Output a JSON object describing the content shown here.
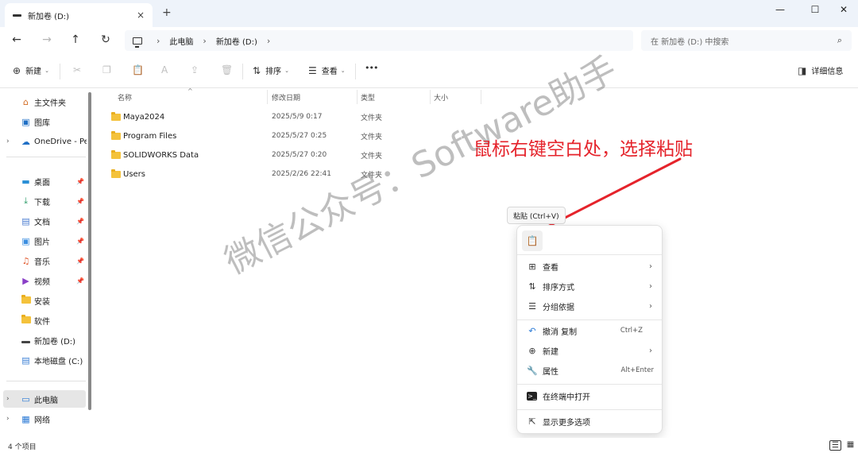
{
  "window": {
    "tab_title": "新加卷 (D:)",
    "tab_close_icon": "×",
    "new_tab_icon": "+",
    "minimize_icon": "—",
    "maximize_icon": "☐",
    "close_icon": "✕"
  },
  "address_bar": {
    "back_icon": "←",
    "forward_icon": "→",
    "up_icon": "↑",
    "refresh_icon": "↻",
    "separator": "›",
    "crumbs": [
      "此电脑",
      "新加卷 (D:)"
    ],
    "search_placeholder": "在 新加卷 (D:) 中搜索",
    "search_icon": "⌕"
  },
  "toolbar": {
    "new_icon": "⊕",
    "new_label": "新建",
    "cut_icon": "✂",
    "copy_icon": "❐",
    "paste_icon": "📋",
    "rename_icon": "A",
    "share_icon": "⇪",
    "delete_icon": "🗑",
    "sort_icon": "⇅",
    "sort_label": "排序",
    "view_icon": "☰",
    "view_label": "查看",
    "more_icon": "•••",
    "details_icon": "◨",
    "details_label": "详细信息",
    "chevron": "⌄"
  },
  "sidebar": {
    "items": [
      {
        "label": "主文件夹",
        "icon": "⌂",
        "color": "#d2691e"
      },
      {
        "label": "图库",
        "icon": "▣",
        "color": "#1f6fc5"
      },
      {
        "label": "OneDrive - Per",
        "icon": "☁",
        "color": "#1f6fc5"
      },
      {
        "label": "桌面",
        "icon": "▬",
        "color": "#2a8fd6"
      },
      {
        "label": "下载",
        "icon": "⤓",
        "color": "#2e9c6a"
      },
      {
        "label": "文档",
        "icon": "▤",
        "color": "#4a7bd0"
      },
      {
        "label": "图片",
        "icon": "▣",
        "color": "#3b8ee0"
      },
      {
        "label": "音乐",
        "icon": "♫",
        "color": "#e0582c"
      },
      {
        "label": "视频",
        "icon": "▶",
        "color": "#8a3fc7"
      },
      {
        "label": "安装",
        "icon": "folder"
      },
      {
        "label": "软件",
        "icon": "folder"
      },
      {
        "label": "新加卷 (D:)",
        "icon": "drive"
      },
      {
        "label": "本地磁盘 (C:)",
        "icon": "▤",
        "color": "#3b7fd4"
      },
      {
        "label": "此电脑",
        "icon": "▭",
        "color": "#2b7ad6"
      },
      {
        "label": "网络",
        "icon": "▦",
        "color": "#2b7ad6"
      }
    ],
    "expand_icon": "›",
    "pin_icon": "📌"
  },
  "columns": {
    "name": "名称",
    "date": "修改日期",
    "type": "类型",
    "size": "大小",
    "sort_caret": "^"
  },
  "files": [
    {
      "name": "Maya2024",
      "date": "2025/5/9 0:17",
      "type": "文件夹"
    },
    {
      "name": "Program Files",
      "date": "2025/5/27 0:25",
      "type": "文件夹"
    },
    {
      "name": "SOLIDWORKS Data",
      "date": "2025/5/27 0:20",
      "type": "文件夹"
    },
    {
      "name": "Users",
      "date": "2025/2/26 22:41",
      "type": "文件夹"
    }
  ],
  "annotation": {
    "text": "鼠标右键空白处，选择粘贴",
    "color": "#e5232b",
    "watermark": "微信公众号：Software助手"
  },
  "tooltip": "粘贴 (Ctrl+V)",
  "context_menu": {
    "paste_icon": "📋",
    "items": [
      {
        "label": "查看",
        "icon": "⊞",
        "arrow": "›"
      },
      {
        "label": "排序方式",
        "icon": "⇅",
        "arrow": "›"
      },
      {
        "label": "分组依据",
        "icon": "☰",
        "arrow": "›"
      },
      {
        "label": "撤消 复制",
        "icon": "↶",
        "shortcut": "Ctrl+Z"
      },
      {
        "label": "新建",
        "icon": "⊕",
        "arrow": "›"
      },
      {
        "label": "属性",
        "icon": "🔧",
        "shortcut": "Alt+Enter"
      },
      {
        "label": "在终端中打开",
        "icon": ">_"
      },
      {
        "label": "显示更多选项",
        "icon": "⇱"
      }
    ]
  },
  "status": {
    "count": "4 个项目",
    "details_view_icon": "☰",
    "tiles_view_icon": "▦"
  }
}
